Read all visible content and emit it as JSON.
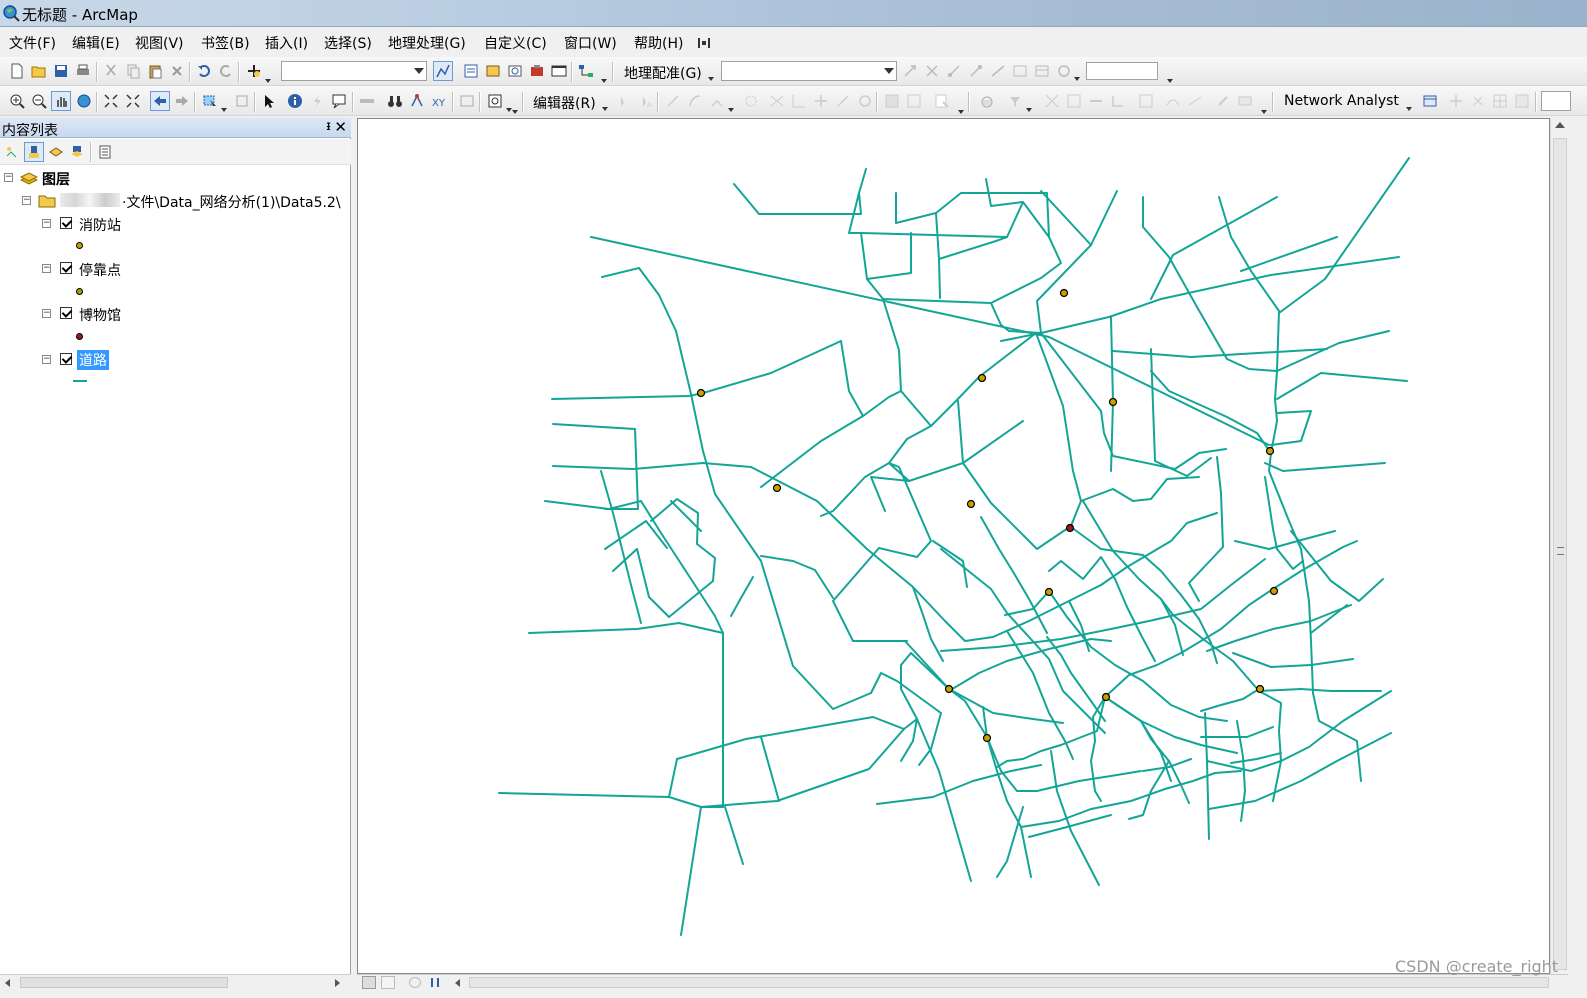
{
  "window": {
    "title": "无标题 - ArcMap"
  },
  "menu": [
    {
      "label": "文件(F)"
    },
    {
      "label": "编辑(E)"
    },
    {
      "label": "视图(V)"
    },
    {
      "label": "书签(B)"
    },
    {
      "label": "插入(I)"
    },
    {
      "label": "选择(S)"
    },
    {
      "label": "地理处理(G)"
    },
    {
      "label": "自定义(C)"
    },
    {
      "label": "窗口(W)"
    },
    {
      "label": "帮助(H)"
    }
  ],
  "toolbars": {
    "georef_label": "地理配准(G)",
    "editor_label": "编辑器(R)",
    "network_label": "Network Analyst",
    "scale_value": "",
    "georef_layer_value": "",
    "layer_combo_value": ""
  },
  "toc": {
    "title": "内容列表",
    "pin": "ᵻ",
    "close": "✕",
    "root_label": "图层",
    "folder_label": "·文件\\Data_网络分析(1)\\Data5.2\\",
    "layers": [
      {
        "label": "消防站",
        "symbol_color": "#8a6d00",
        "type": "point"
      },
      {
        "label": "停靠点",
        "symbol_color": "#6b6b00",
        "type": "point"
      },
      {
        "label": "博物馆",
        "symbol_color": "#8b1a1a",
        "type": "point"
      },
      {
        "label": "道路",
        "symbol_color": "#13a596",
        "type": "line"
      }
    ]
  },
  "map": {
    "road_color": "#13a596",
    "point_fill": "#c8a000",
    "museum_fill": "#9b1b1b"
  },
  "watermark": "CSDN @create_right"
}
